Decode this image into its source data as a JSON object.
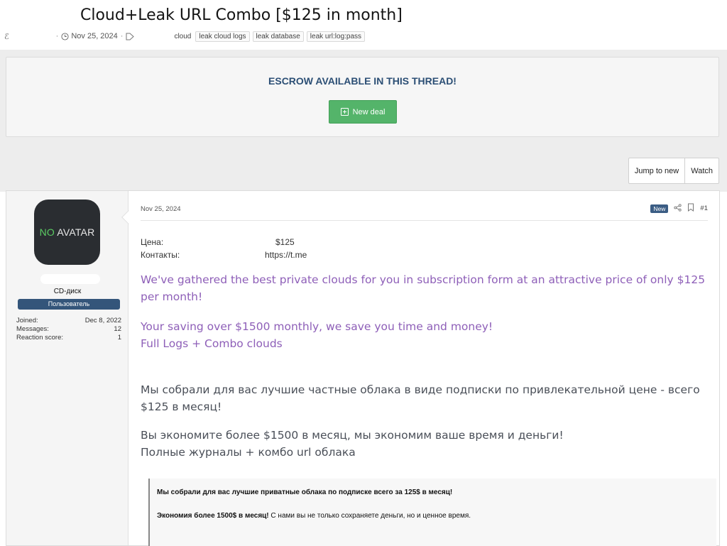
{
  "thread": {
    "title": "Cloud+Leak URL Combo [$125 in month]",
    "date": "Nov 25, 2024",
    "tags": [
      "cloud",
      "leak cloud logs",
      "leak database",
      "leak url:log:pass"
    ]
  },
  "escrow": {
    "title": "ESCROW AVAILABLE IN THIS THREAD!",
    "button_label": "New deal"
  },
  "actions": {
    "jump_to_new": "Jump to new",
    "watch": "Watch"
  },
  "user": {
    "avatar_no": "NO",
    "avatar_avatar": " AVATAR",
    "title": "CD-диск",
    "banner": "Пользователь",
    "stats": [
      {
        "label": "Joined:",
        "value": "Dec 8, 2022"
      },
      {
        "label": "Messages:",
        "value": "12"
      },
      {
        "label": "Reaction score:",
        "value": "1"
      }
    ]
  },
  "post": {
    "date": "Nov 25, 2024",
    "badge": "New",
    "number": "#1",
    "fields": [
      {
        "label": "Цена:",
        "value": "$125"
      },
      {
        "label": "Контакты:",
        "value": "https://t.me"
      }
    ],
    "p1": "We've gathered the best private clouds for you in subscription form at an attractive price of only $125 per month!",
    "p2": "Your saving over $1500 monthly, we save you time and money!",
    "p3": "Full Logs + Combo clouds",
    "p4": "Мы собрали для вас лучшие частные облака в виде подписки по привлекательной цене - всего $125 в месяц!",
    "p5": "Вы экономите более $1500 в месяц, мы экономим ваше время и деньги!",
    "p6": "Полные журналы + комбо url облака",
    "quote1": "Мы собрали для вас лучшие приватные облака по подписке всего за 125$ в месяц!",
    "quote2_bold": "Экономия более 1500$ в месяц!",
    "quote2_rest": " С нами вы не только сохраняете деньги, но и ценное время."
  },
  "colors": {
    "banner": "#34557a",
    "escrow_title": "#2c4f75",
    "new_deal": "#54b46a",
    "purple_text": "#8e5fb8"
  }
}
